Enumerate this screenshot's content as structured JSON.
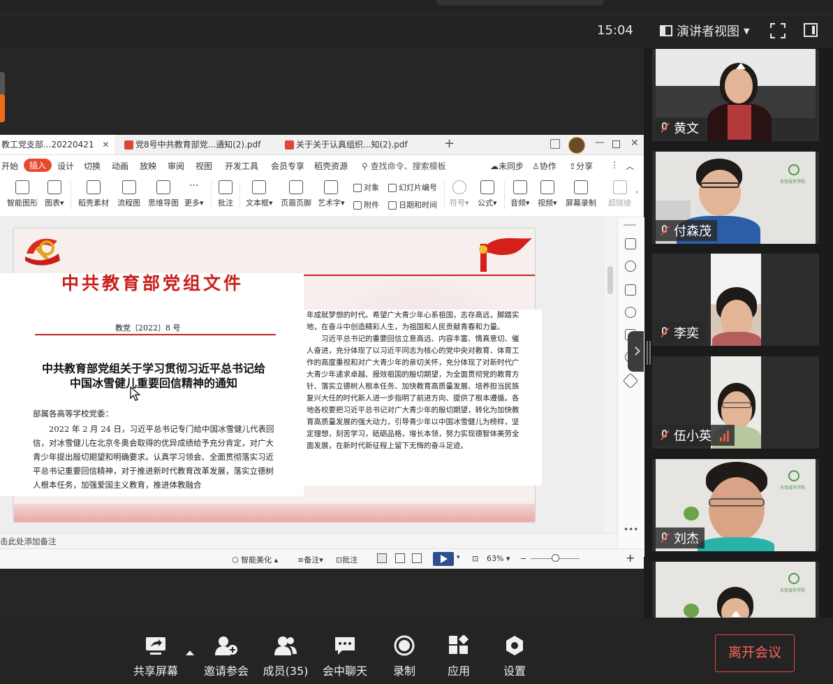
{
  "topbar": {
    "clock": "15:04",
    "view_mode": "演讲者视图"
  },
  "wps": {
    "tabs": [
      {
        "label": "教工党支部...20220421"
      },
      {
        "label": "党8号中共教育部党...通知(2).pdf"
      },
      {
        "label": "关于关于认真组织...知(2).pdf"
      }
    ],
    "menu": [
      "开始",
      "插入",
      "设计",
      "切换",
      "动画",
      "放映",
      "审阅",
      "视图",
      "开发工具",
      "会员专享",
      "稻壳资源"
    ],
    "search_placeholder": "查找命令、搜索模板",
    "menu_right": {
      "sync": "未同步",
      "collab": "协作",
      "share": "分享"
    },
    "ribbon": {
      "smart_shape": "智能图形",
      "chart": "图表",
      "daoke": "稻壳素材",
      "flowchart": "流程图",
      "mindmap": "思维导图",
      "more": "更多",
      "comment": "批注",
      "textbox": "文本框",
      "header_footer": "页眉页脚",
      "wordart": "艺术字",
      "object": "对象",
      "attachment": "附件",
      "slide_no": "幻灯片编号",
      "datetime": "日期和时间",
      "symbol": "符号",
      "formula": "公式",
      "audio": "音频",
      "video": "视频",
      "screen_rec": "屏幕录制",
      "hyperlink": "超链接"
    },
    "note_hint": "击此处添加备注",
    "status": {
      "beautify": "智能美化",
      "notes": "备注",
      "comments": "批注",
      "zoom": "63%"
    }
  },
  "document": {
    "header": "中共教育部党组文件",
    "doc_no": "教党〔2022〕8 号",
    "title_line1": "中共教育部党组关于学习贯彻习近平总书记给",
    "title_line2": "中国冰雪健儿重要回信精神的通知",
    "salutation": "部属各高等学校党委：",
    "body_left": "2022 年 2 月 24 日，习近平总书记专门给中国冰雪健儿代表回信，对冰雪健儿在北京冬奥会取得的优异成绩给予充分肯定，对广大青少年提出殷切期望和明确要求。认真学习领会、全面贯彻落实习近平总书记重要回信精神，对于推进新时代教育改革发展，落实立德树人根本任务，加强爱国主义教育，推进体教融合",
    "body_right_p1": "年成就梦想的时代。希望广大青少年心系祖国，志存高远，脚踏实地，在奋斗中创造精彩人生，为祖国和人民贡献青春和力量。",
    "body_right_p2": "习近平总书记的重要回信立意高远、内容丰富、情真意切、催人奋进，充分体现了以习近平同志为核心的党中央对教育、体育工作的高度重视和对广大青少年的亲切关怀，充分体现了对新时代广大青少年递求卓越、报效祖国的殷切期望，为全面贯彻党的教育方针、落实立德树人根本任务、加快教育高质量发展、培养担当民族复兴大任的时代新人进一步指明了前进方向、提供了根本遵循。各地各校要把习近平总书记对广大青少年的殷切期望，转化为加快教育高质量发展的强大动力，引导青少年以中国冰雪健儿为榜样，坚定理想，刻苦学习，砥砺品格，增长本领，努力实现德智体美劳全面发展，在新时代新征程上留下无悔的奋斗足迹。"
  },
  "participants": [
    {
      "name": "黄文"
    },
    {
      "name": "付森茂"
    },
    {
      "name": "李奕"
    },
    {
      "name": "伍小英"
    },
    {
      "name": "刘杰"
    },
    {
      "name": ""
    }
  ],
  "toolbar": {
    "share_screen": "共享屏幕",
    "invite": "邀请参会",
    "members": "成员(35)",
    "chat": "会中聊天",
    "record": "录制",
    "apps": "应用",
    "settings": "设置",
    "leave": "离开会议"
  },
  "colors": {
    "accent_orange": "#ee6e18",
    "leave_red": "#ff6258",
    "wps_active_tab": "#e8492f",
    "doc_red": "#c81e1a"
  }
}
